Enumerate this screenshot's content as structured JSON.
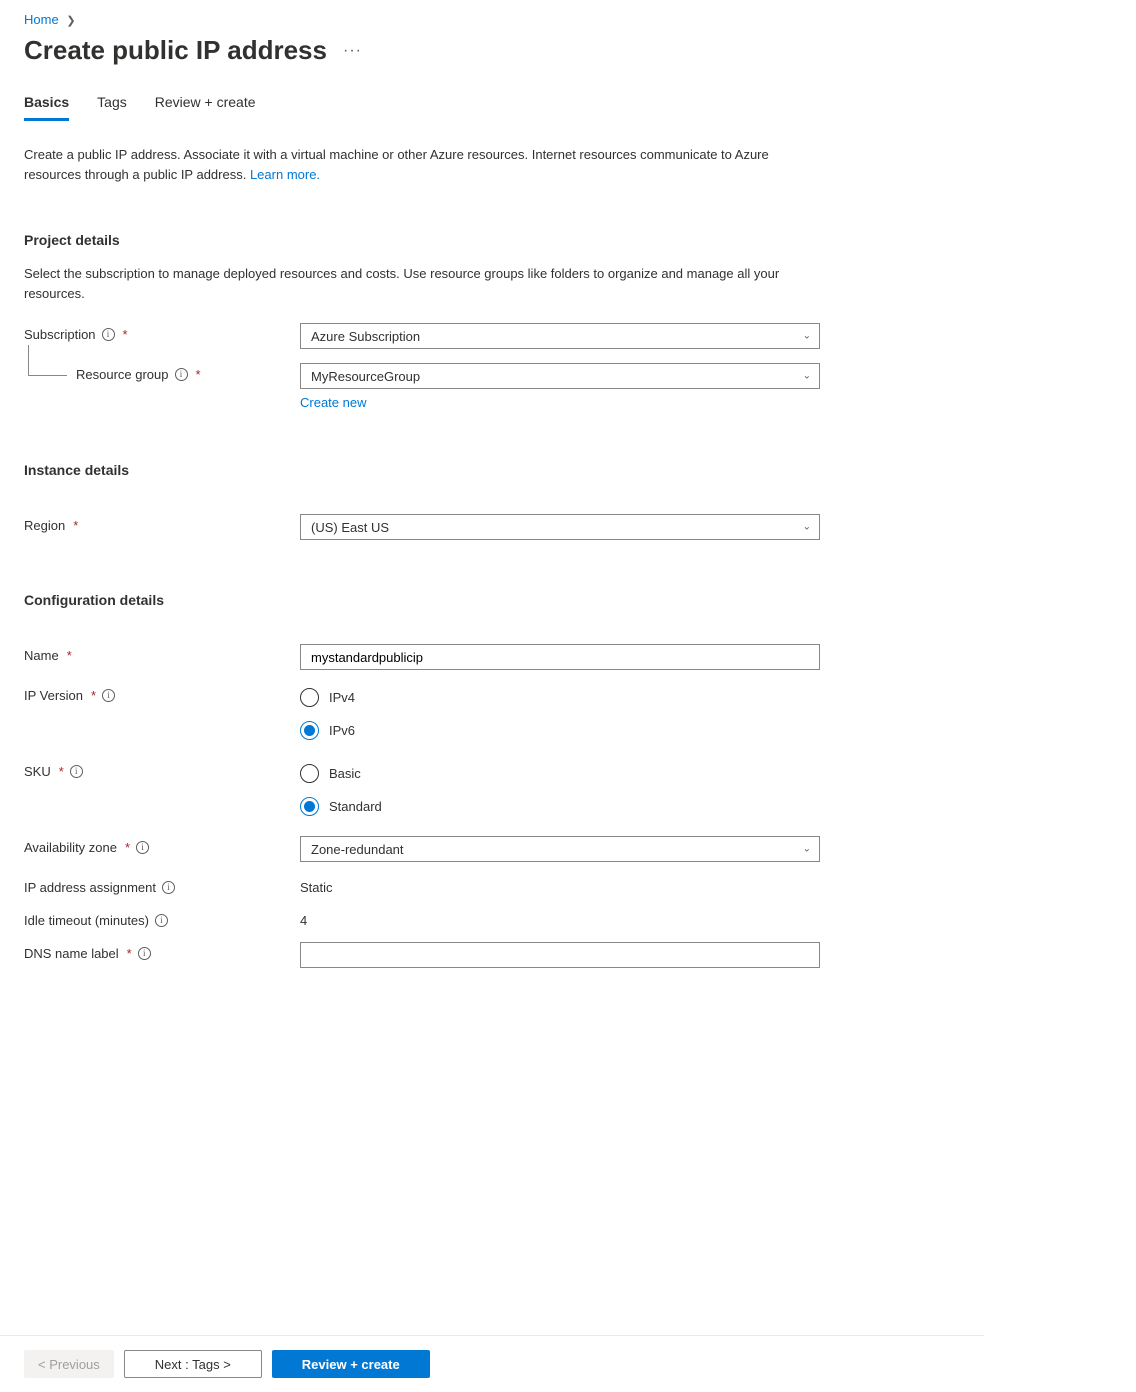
{
  "breadcrumb": {
    "home": "Home"
  },
  "page": {
    "title": "Create public IP address"
  },
  "tabs": {
    "basics": "Basics",
    "tags": "Tags",
    "review": "Review + create"
  },
  "intro": {
    "text": "Create a public IP address. Associate it with a virtual machine or other Azure resources. Internet resources communicate to Azure resources through a public IP address. ",
    "learn_more": "Learn more."
  },
  "project": {
    "heading": "Project details",
    "desc": "Select the subscription to manage deployed resources and costs. Use resource groups like folders to organize and manage all your resources.",
    "subscription_label": "Subscription",
    "subscription_value": "Azure Subscription",
    "rg_label": "Resource group",
    "rg_value": "MyResourceGroup",
    "create_new": "Create new"
  },
  "instance": {
    "heading": "Instance details",
    "region_label": "Region",
    "region_value": "(US) East US"
  },
  "config": {
    "heading": "Configuration details",
    "name_label": "Name",
    "name_value": "mystandardpublicip",
    "ipversion_label": "IP Version",
    "ipv4": "IPv4",
    "ipv6": "IPv6",
    "sku_label": "SKU",
    "sku_basic": "Basic",
    "sku_standard": "Standard",
    "az_label": "Availability zone",
    "az_value": "Zone-redundant",
    "assign_label": "IP address assignment",
    "assign_value": "Static",
    "idle_label": "Idle timeout (minutes)",
    "idle_value": "4",
    "dns_label": "DNS name label"
  },
  "footer": {
    "prev": "< Previous",
    "next": "Next : Tags >",
    "review": "Review + create"
  }
}
